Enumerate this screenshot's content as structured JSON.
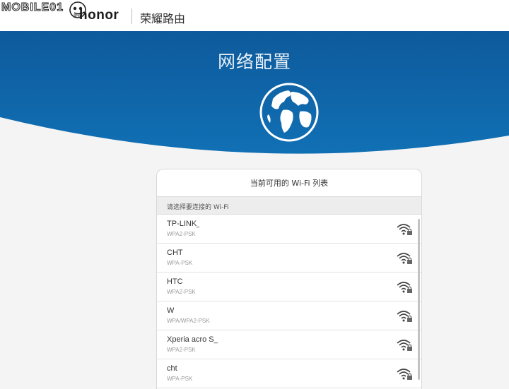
{
  "watermark": {
    "text": "MOBILE01"
  },
  "header": {
    "brand_small": "荣耀",
    "brand": "honor",
    "product": "荣耀路由"
  },
  "hero": {
    "title": "网络配置",
    "icon": "globe-icon",
    "color_top": "#0d5a9c",
    "color_bottom": "#0f6fb3"
  },
  "card": {
    "title": "当前可用的 Wi-Fi 列表",
    "subtitle": "请选择要连接的 Wi-Fi"
  },
  "networks": [
    {
      "ssid": "TP-LINK_",
      "security": "WPA2-PSK",
      "icon": "wifi-locked-icon"
    },
    {
      "ssid": "CHT",
      "security": "WPA-PSK",
      "icon": "wifi-locked-icon"
    },
    {
      "ssid": "HTC",
      "security": "WPA2-PSK",
      "icon": "wifi-locked-icon"
    },
    {
      "ssid": "W",
      "security": "WPA/WPA2-PSK",
      "icon": "wifi-locked-icon"
    },
    {
      "ssid": "Xperia acro S_",
      "security": "WPA2-PSK",
      "icon": "wifi-locked-icon"
    },
    {
      "ssid": "cht",
      "security": "WPA-PSK",
      "icon": "wifi-locked-icon"
    }
  ]
}
